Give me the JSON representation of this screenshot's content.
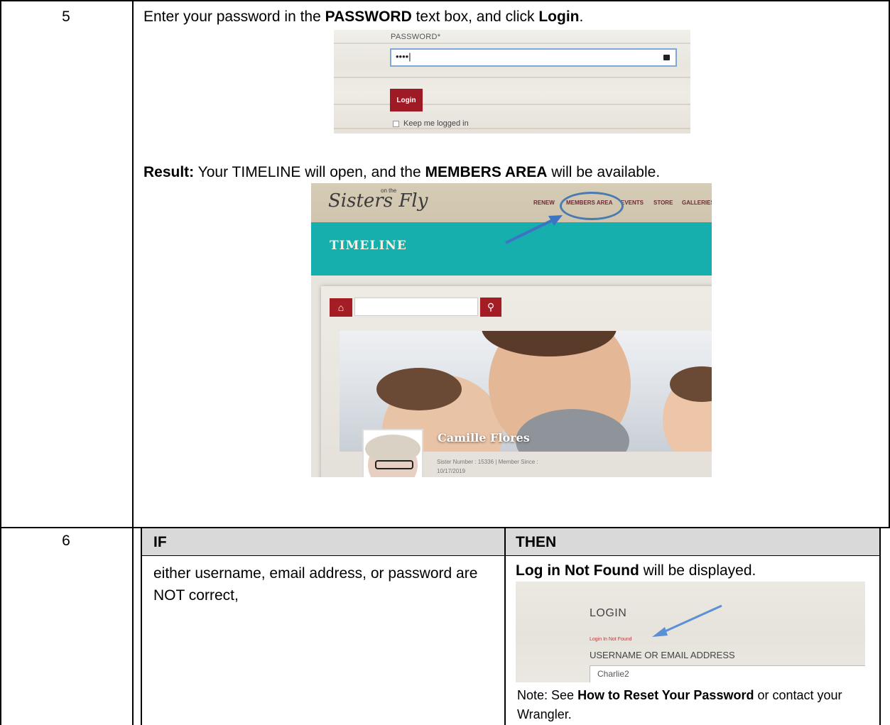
{
  "row5": {
    "number": "5",
    "instruction_pre": "Enter your password in the ",
    "instruction_bold1": "PASSWORD",
    "instruction_mid": " text box, and click ",
    "instruction_bold2": "Login",
    "instruction_post": ".",
    "login_screenshot": {
      "password_label": "PASSWORD*",
      "password_value": "••••|",
      "login_button": "Login",
      "keep_logged_in": "Keep me logged in"
    },
    "result_bold": "Result:",
    "result_text1": " Your TIMELINE will open, and the ",
    "result_bold2": "MEMBERS AREA",
    "result_text2": " will be available.",
    "timeline_screenshot": {
      "logo": "Sisters",
      "logo_tail": "Fly",
      "logo_sup": "on the",
      "nav": [
        "RENEW",
        "MEMBERS AREA",
        "EVENTS",
        "STORE",
        "GALLERIES"
      ],
      "band_title": "TIMELINE",
      "profile_name": "Camille Flores",
      "profile_meta_line1": "Sister Number : 15336 | Member Since :",
      "profile_meta_line2": "10/17/2019"
    }
  },
  "row6": {
    "number": "6",
    "if_header": "IF",
    "then_header": "THEN",
    "if_text": "either username, email address, or password are NOT correct,",
    "then_bold": "Log in Not Found",
    "then_text": " will be displayed.",
    "error_screenshot": {
      "title": "LOGIN",
      "error": "Login In Not Found",
      "username_label": "USERNAME OR EMAIL ADDRESS",
      "username_value": "Charlie2"
    },
    "note_pre": "Note: See ",
    "note_bold": "How to Reset Your Password",
    "note_post": " or contact your Wrangler."
  },
  "colors": {
    "accent_red": "#a51d24",
    "teal": "#17aeae",
    "arrow_blue": "#4a7bb0",
    "header_grey": "#d9d9d9"
  }
}
